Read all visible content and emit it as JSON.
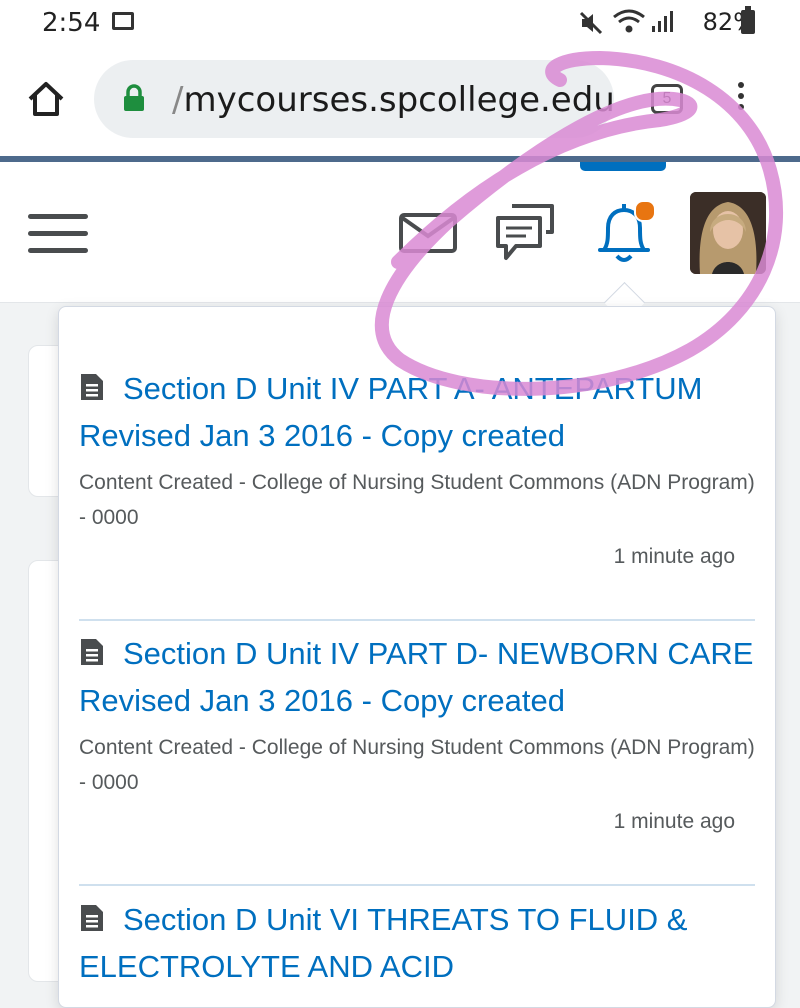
{
  "status_bar": {
    "time": "2:54",
    "battery": "82%"
  },
  "browser": {
    "url_prefix": "/",
    "url": "mycourses.spcollege.edu",
    "tab_count": "5"
  },
  "notifications": [
    {
      "title": "Section D Unit IV PART A- ANTEPARTUM Revised Jan 3 2016 - Copy created",
      "description": "Content Created - College of Nursing Student Commons (ADN Program) - 0000",
      "time": "1 minute ago"
    },
    {
      "title": "Section D Unit IV PART D- NEWBORN CARE Revised Jan 3 2016 - Copy created",
      "description": "Content Created - College of Nursing Student Commons (ADN Program) - 0000",
      "time": "1 minute ago"
    },
    {
      "title": "Section D Unit VI THREATS TO FLUID & ELECTROLYTE AND ACID",
      "description": "",
      "time": ""
    }
  ],
  "colors": {
    "link": "#006fbf",
    "badge": "#e87511",
    "annotation": "#d98ad3"
  }
}
